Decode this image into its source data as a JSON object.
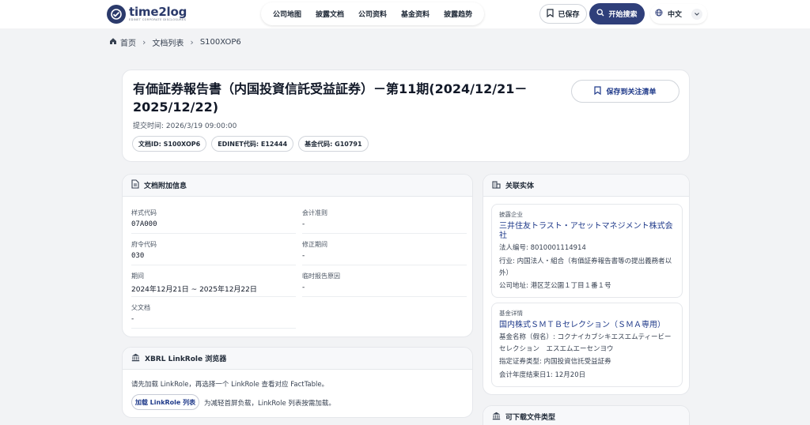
{
  "header": {
    "logo": "time2log",
    "logo_sub": "EDINET CORPORATE DISCLOSURES",
    "nav": [
      "公司地图",
      "披露文档",
      "公司资料",
      "基金资料",
      "披露趋势"
    ],
    "saved_label": "已保存",
    "search_label": "开始搜索",
    "lang_label": "中文"
  },
  "breadcrumb": {
    "home": "首页",
    "list": "文档列表",
    "current": "S100XOP6"
  },
  "document": {
    "title": "有価証券報告書（内国投資信託受益証券）－第11期(2024/12/21－2025/12/22)",
    "submitted": "提交时间: 2026/3/19 09:00:00",
    "chips": [
      "文档ID: S100XOP6",
      "EDINET代码: E12444",
      "基金代码: G10791"
    ],
    "follow_label": "保存到关注清单"
  },
  "info": {
    "title": "文档附加信息",
    "fields": [
      {
        "label": "样式代码",
        "value": "07A000"
      },
      {
        "label": "会计准则",
        "value": "-"
      },
      {
        "label": "府令代码",
        "value": "030"
      },
      {
        "label": "修正期间",
        "value": "-"
      },
      {
        "label": "期间",
        "value": "2024年12月21日 ~ 2025年12月22日"
      },
      {
        "label": "临时报告原因",
        "value": "-"
      },
      {
        "label": "父文档",
        "value": "-"
      }
    ]
  },
  "xbrl": {
    "title": "XBRL LinkRole 浏览器",
    "text": "请先加载 LinkRole，再选择一个 LinkRole 查看对应 FactTable。",
    "load_label": "加载 LinkRole 列表",
    "hint": "为减轻首屏负载，LinkRole 列表按需加载。"
  },
  "entities": {
    "title": "关联实体",
    "company": {
      "label": "披露企业",
      "name": "三井住友トラスト・アセットマネジメント株式会社",
      "corp_no": "法人编号: 8010001114914",
      "industry": "行业: 内国法人・組合（有価証券報告書等の提出義務者以外）",
      "address": "公司地址: 港区芝公園１丁目１番１号"
    },
    "fund": {
      "label": "基金详情",
      "name": "国内株式ＳＭＴＢセレクション（ＳＭＡ専用）",
      "kana": "基金名称（假名）: コクナイカブシキエスエムティービーセレクション　エスエムエーセンヨウ",
      "security_type": "指定证券类型: 内国投資信託受益証券",
      "fiscal_end": "会计年度结束日1: 12月20日"
    }
  },
  "downloads": {
    "title": "可下载文件类型"
  }
}
